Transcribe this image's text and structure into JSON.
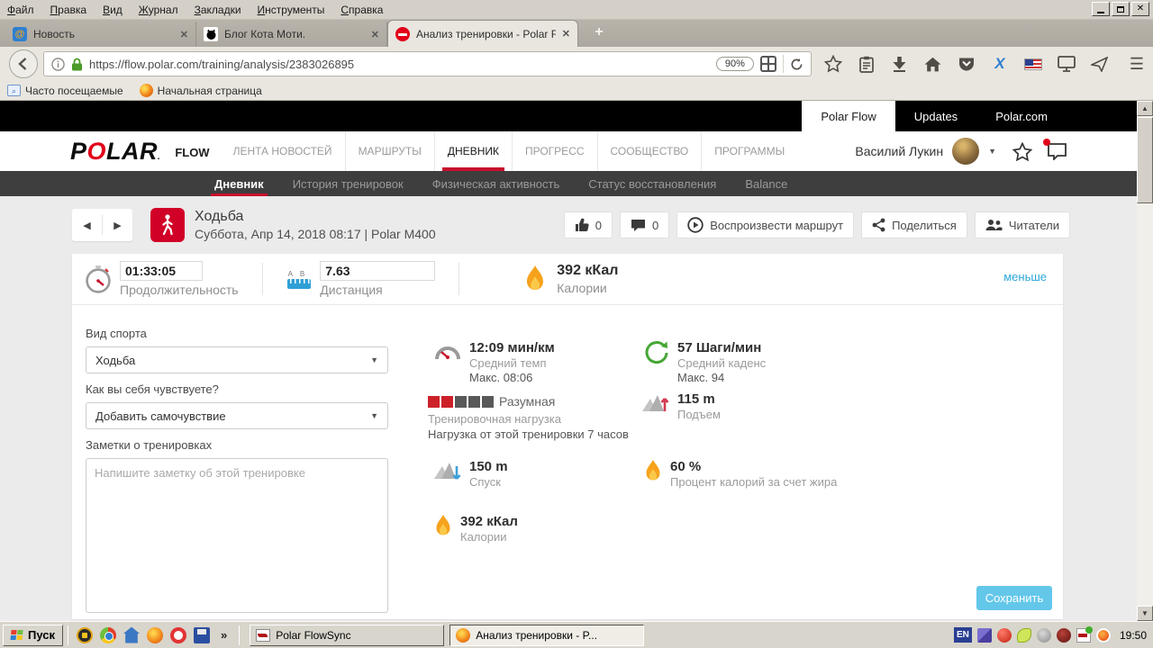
{
  "browser": {
    "menu": [
      "Файл",
      "Правка",
      "Вид",
      "Журнал",
      "Закладки",
      "Инструменты",
      "Справка"
    ],
    "tabs": [
      {
        "title": "Новость"
      },
      {
        "title": "Блог Кота Моти."
      },
      {
        "title": "Анализ тренировки - Polar F..."
      }
    ],
    "url": "https://flow.polar.com/training/analysis/2383026895",
    "zoom_level": "90%",
    "bookmarks": [
      "Часто посещаемые",
      "Начальная страница"
    ]
  },
  "site": {
    "top_tabs": [
      "Polar Flow",
      "Updates",
      "Polar.com"
    ],
    "logo_p": "P",
    "logo_o": "O",
    "logo_lar": "LAR",
    "flow": "FLOW",
    "nav": [
      "ЛЕНТА НОВОСТЕЙ",
      "МАРШРУТЫ",
      "ДНЕВНИК",
      "ПРОГРЕСС",
      "СООБЩЕСТВО",
      "ПРОГРАММЫ"
    ],
    "user": "Василий Лукин",
    "subnav": [
      "Дневник",
      "История тренировок",
      "Физическая активность",
      "Статус восстановления",
      "Balance"
    ]
  },
  "training": {
    "title": "Ходьба",
    "meta": "Суббота, Апр 14, 2018 08:17 | Polar M400",
    "likes": "0",
    "comments": "0",
    "replay_label": "Воспроизвести маршрут",
    "share_label": "Поделиться",
    "followers_label": "Читатели",
    "less_link": "меньше"
  },
  "summary": {
    "duration_value": "01:33:05",
    "duration_label": "Продолжительность",
    "distance_value": "7.63",
    "distance_label": "Дистанция",
    "calories_value": "392 кКал",
    "calories_label": "Калории"
  },
  "form": {
    "sport_label": "Вид спорта",
    "sport_value": "Ходьба",
    "feeling_label": "Как вы себя чувствуете?",
    "feeling_value": "Добавить самочувствие",
    "notes_label": "Заметки о тренировках",
    "notes_placeholder": "Напишите заметку об этой тренировке",
    "save_label": "Сохранить"
  },
  "stats": {
    "pace_value": "12:09 мин/км",
    "pace_label": "Средний темп",
    "pace_max": "Макс. 08:06",
    "cadence_value": "57 Шаги/мин",
    "cadence_label": "Средний каденс",
    "cadence_max": "Макс. 94",
    "load_value": "Разумная",
    "load_label": "Тренировочная нагрузка",
    "load_desc": "Нагрузка от этой тренировки 7 часов",
    "load_filled": 2,
    "load_total": 5,
    "ascent_value": "115 m",
    "ascent_label": "Подъем",
    "descent_value": "150 m",
    "descent_label": "Спуск",
    "fat_value": "60 %",
    "fat_label": "Процент калорий за счет жира",
    "calories_value": "392 кКал",
    "calories_label": "Калории"
  },
  "taskbar": {
    "start": "Пуск",
    "task1": "Polar FlowSync",
    "task2": "Анализ тренировки - P...",
    "lang": "EN",
    "time": "19:50"
  },
  "colors": {
    "polar_red": "#d10027",
    "link_blue": "#2ba7d9",
    "save_blue": "#63c7ea",
    "load_red": "#cc2129"
  }
}
